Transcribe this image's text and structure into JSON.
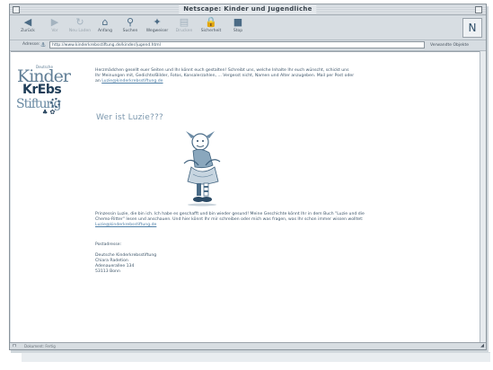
{
  "window": {
    "title": "Netscape: Kinder und Jugendliche"
  },
  "toolbar": {
    "buttons": [
      {
        "label": "Zurück",
        "icon": "back-arrow-icon"
      },
      {
        "label": "Vor",
        "icon": "forward-arrow-icon"
      },
      {
        "label": "Neu Laden",
        "icon": "reload-icon"
      },
      {
        "label": "Anfang",
        "icon": "home-icon"
      },
      {
        "label": "Suchen",
        "icon": "search-icon"
      },
      {
        "label": "Wegweiser",
        "icon": "guide-icon"
      },
      {
        "label": "Drucken",
        "icon": "print-icon"
      },
      {
        "label": "Sicherheit",
        "icon": "security-icon"
      },
      {
        "label": "Stop",
        "icon": "stop-icon"
      }
    ]
  },
  "location": {
    "label": "Adresse:",
    "url": "http://www.kinderkrebsstiftung.de/kinder/jugend.html",
    "related": "Verwandte Objekte"
  },
  "page": {
    "logo": {
      "line1": "Kinder",
      "line1_small": "Deutsche",
      "line2": "KrEbs",
      "line3": "Stiftung"
    },
    "intro": "Herzmädchen gesellt euer Seiten und Ihr könnt euch gestalten! Schreibt uns, welche Inhalte Ihr euch wünscht, schickt uns Ihr Meinungen mit, Gedichte/Bilder, Fotos, Konsalerzahlen, ... Vergesst nicht, Namen und Alter anzugeben. Mail per Post oder an",
    "intro_link": "Luzie@kinderkrebsstiftung.de",
    "heading": "Wer ist Luzie???",
    "para2": "Prinzessin Luzie, die bin ich. Ich habe es geschafft und bin wieder gesund! Meine Geschichte könnt Ihr in dem Buch \"Luzie und die Chemo-Ritter\" lesen und anschauen. Und hier könnt Ihr mir schreiben oder mich was fragen, was Ihr schon immer wissen wolltet:",
    "para2_link": "Luzie@kinderkrebsstiftung.de",
    "postal_label": "Postadresse:",
    "address": [
      "Deutsche Kinderkrebsstiftung",
      "Chiara Radetion",
      "Adenauerallee 134",
      "53113 Bonn"
    ]
  },
  "status": {
    "message": "Dokument: Fertig"
  }
}
